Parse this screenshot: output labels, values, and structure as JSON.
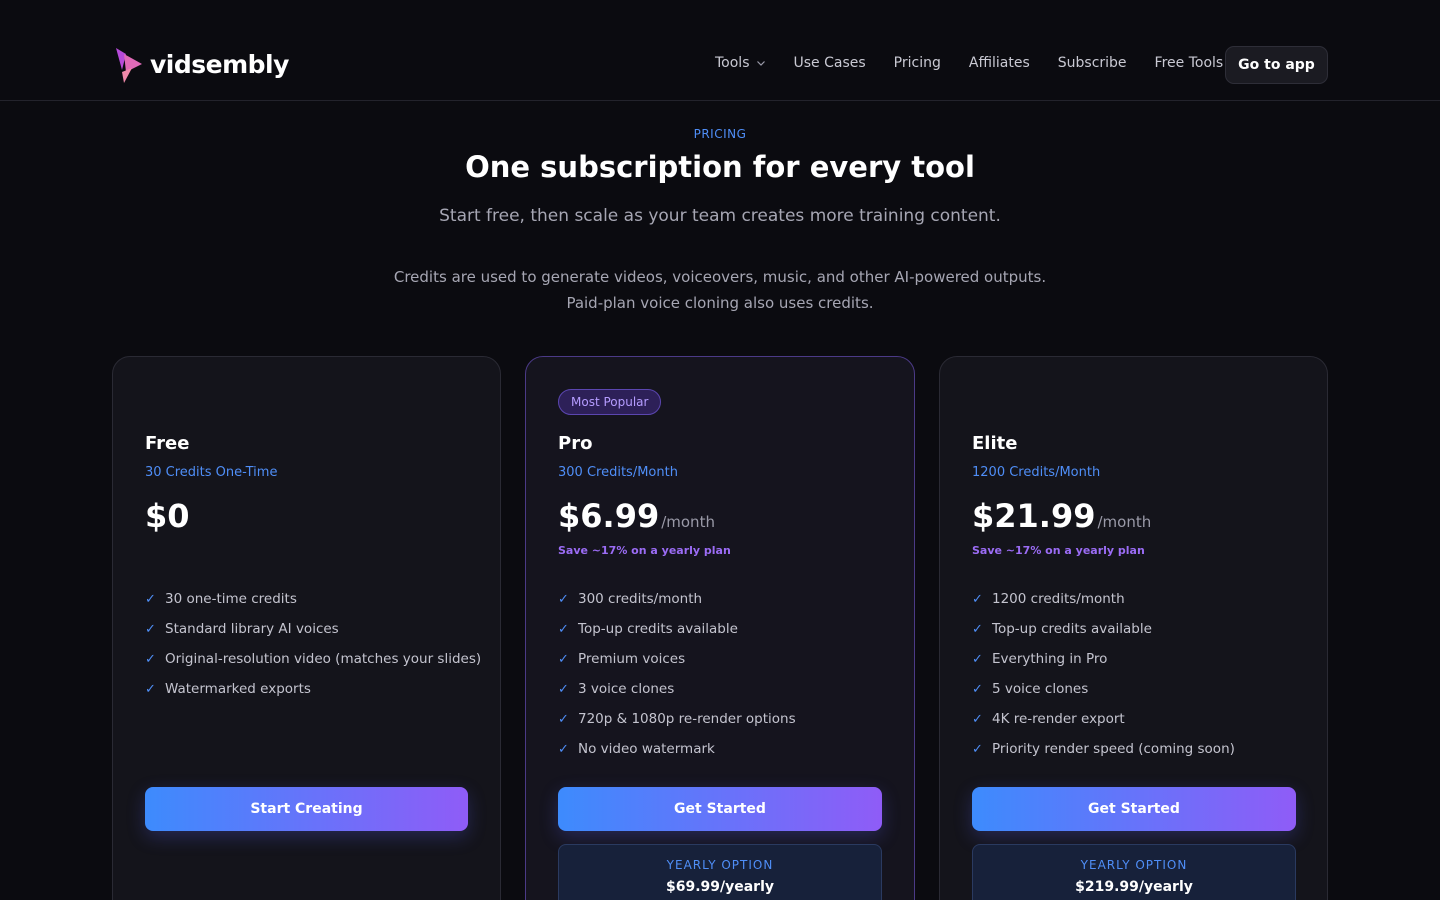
{
  "header": {
    "logo_text": "vidsembly",
    "nav": [
      {
        "label": "Tools",
        "has_dropdown": true
      },
      {
        "label": "Use Cases"
      },
      {
        "label": "Pricing"
      },
      {
        "label": "Affiliates"
      },
      {
        "label": "Subscribe"
      },
      {
        "label": "Free Tools"
      }
    ],
    "cta_label": "Go to app"
  },
  "hero": {
    "eyebrow": "PRICING",
    "title": "One subscription for every tool",
    "subtitle": "Start free, then scale as your team creates more training content.",
    "note": "Credits are used to generate videos, voiceovers, music, and other AI-powered outputs. Paid-plan voice cloning also uses credits."
  },
  "plans": [
    {
      "name": "Free",
      "credits": "30 Credits One-Time",
      "price": "$0",
      "period": "",
      "save": "",
      "features": [
        "30 one-time credits",
        "Standard library AI voices",
        "Original-resolution video (matches your slides)",
        "Watermarked exports"
      ],
      "cta": "Start Creating"
    },
    {
      "badge": "Most Popular",
      "name": "Pro",
      "credits": "300 Credits/Month",
      "price": "$6.99",
      "period": "/month",
      "save": "Save ~17% on a yearly plan",
      "features": [
        "300 credits/month",
        "Top-up credits available",
        "Premium voices",
        "3 voice clones",
        "720p & 1080p re-render options",
        "No video watermark"
      ],
      "cta": "Get Started",
      "yearly_label": "YEARLY OPTION",
      "yearly_price": "$69.99/yearly"
    },
    {
      "name": "Elite",
      "credits": "1200 Credits/Month",
      "price": "$21.99",
      "period": "/month",
      "save": "Save ~17% on a yearly plan",
      "features": [
        "1200 credits/month",
        "Top-up credits available",
        "Everything in Pro",
        "5 voice clones",
        "4K re-render export",
        "Priority render speed (coming soon)"
      ],
      "cta": "Get Started",
      "yearly_label": "YEARLY OPTION",
      "yearly_price": "$219.99/yearly"
    }
  ],
  "colors": {
    "background": "#0b0b10",
    "accent_blue": "#4f8ef7",
    "accent_purple": "#9b6cf5",
    "card_bg": "#14141b"
  },
  "icons": [
    "logo-mark-icon",
    "chevron-down-icon",
    "check-icon"
  ]
}
